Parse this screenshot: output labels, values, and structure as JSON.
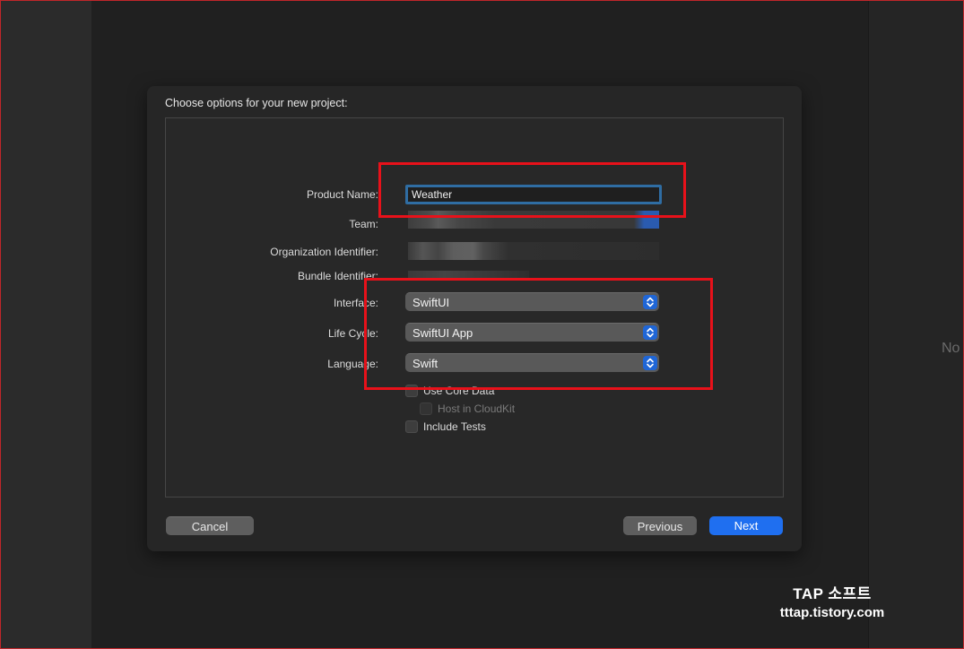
{
  "background": {
    "right_partial_text": "No"
  },
  "sheet": {
    "title": "Choose options for your new project:",
    "fields": {
      "product_name": {
        "label": "Product Name:",
        "value": "Weather"
      },
      "team": {
        "label": "Team:"
      },
      "organization_identifier": {
        "label": "Organization Identifier:"
      },
      "bundle_identifier": {
        "label": "Bundle Identifier:"
      }
    },
    "popups": {
      "interface": {
        "label": "Interface:",
        "value": "SwiftUI"
      },
      "life_cycle": {
        "label": "Life Cycle:",
        "value": "SwiftUI App"
      },
      "language": {
        "label": "Language:",
        "value": "Swift"
      }
    },
    "checkboxes": {
      "use_core_data": {
        "label": "Use Core Data",
        "checked": false
      },
      "host_in_cloudkit": {
        "label": "Host in CloudKit",
        "checked": false,
        "disabled": true
      },
      "include_tests": {
        "label": "Include Tests",
        "checked": false
      }
    },
    "buttons": {
      "cancel": "Cancel",
      "previous": "Previous",
      "next": "Next"
    }
  },
  "watermark": {
    "line1": "TAP 소프트",
    "line2": "tttap.tistory.com"
  },
  "colors": {
    "accent": "#1f6ff0",
    "highlight": "#e8111a",
    "focus_ring": "#2f6da3"
  },
  "icons": {
    "popup_indicator": "chevron-up-down-icon"
  }
}
